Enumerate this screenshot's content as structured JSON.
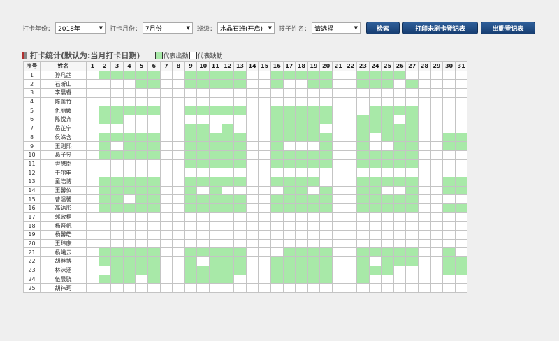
{
  "filters": {
    "year_label": "打卡年份：",
    "year_value": "2018年",
    "month_label": "打卡月份：",
    "month_value": "7月份",
    "class_label": "班级：",
    "class_value": "水晶石班(开启)",
    "child_label": "孩子姓名：",
    "child_value": "请选择"
  },
  "buttons": {
    "search": "检索",
    "print_unswiped": "打印未刷卡登记表",
    "attendance_sheet": "出勤登记表"
  },
  "section": {
    "title": "打卡统计(默认为:当月打卡日期)",
    "legend_present": "代表出勤",
    "legend_absent": "代表缺勤"
  },
  "colors": {
    "present": "#a8e9a8",
    "absent": "#ffffff",
    "accent": "#1f4f8a",
    "marker_red": "#b03030",
    "marker_gray": "#888888"
  },
  "table": {
    "col_index": "序号",
    "col_name": "姓名",
    "days": [
      "1",
      "2",
      "3",
      "4",
      "5",
      "6",
      "7",
      "8",
      "9",
      "10",
      "11",
      "12",
      "13",
      "14",
      "15",
      "16",
      "17",
      "18",
      "19",
      "20",
      "21",
      "22",
      "23",
      "24",
      "25",
      "26",
      "27",
      "28",
      "29",
      "30",
      "31"
    ],
    "rows": [
      {
        "no": "1",
        "name": "孙凡茜",
        "present": [
          2,
          3,
          4,
          5,
          6,
          9,
          10,
          11,
          12,
          13,
          16,
          17,
          18,
          19,
          20,
          23,
          24,
          25,
          26
        ]
      },
      {
        "no": "2",
        "name": "石昕山",
        "present": [
          5,
          6,
          9,
          10,
          11,
          12,
          13,
          16,
          19,
          20,
          23,
          24,
          25,
          27
        ]
      },
      {
        "no": "3",
        "name": "李晨睿",
        "present": []
      },
      {
        "no": "4",
        "name": "陈蕾竹",
        "present": []
      },
      {
        "no": "5",
        "name": "仇丽媛",
        "present": [
          2,
          3,
          4,
          5,
          6,
          9,
          10,
          11,
          12,
          13,
          16,
          17,
          18,
          19,
          20,
          24,
          25,
          26,
          27
        ]
      },
      {
        "no": "6",
        "name": "陈悦齐",
        "present": [
          2,
          3,
          16,
          17,
          18,
          19,
          20,
          23,
          24,
          25,
          27
        ]
      },
      {
        "no": "7",
        "name": "岳芷宁",
        "present": [
          9,
          10,
          12,
          16,
          17,
          18,
          19,
          23,
          24,
          25,
          26,
          27
        ]
      },
      {
        "no": "8",
        "name": "侯姝含",
        "present": [
          2,
          3,
          4,
          5,
          6,
          9,
          10,
          11,
          12,
          13,
          16,
          17,
          18,
          19,
          20,
          23,
          25,
          26,
          27,
          30,
          31
        ]
      },
      {
        "no": "9",
        "name": "王则熙",
        "present": [
          2,
          4,
          5,
          6,
          9,
          10,
          11,
          12,
          13,
          16,
          20,
          23,
          26,
          27,
          30,
          31
        ]
      },
      {
        "no": "10",
        "name": "葛子昱",
        "present": [
          2,
          3,
          4,
          5,
          6,
          9,
          10,
          11,
          12,
          13,
          16,
          17,
          18,
          19,
          20,
          23,
          24,
          25,
          26,
          27
        ]
      },
      {
        "no": "11",
        "name": "尹懋臣",
        "present": [
          9,
          10,
          11,
          12,
          13,
          16,
          17,
          18,
          19,
          20,
          23,
          24,
          25,
          26,
          27
        ]
      },
      {
        "no": "12",
        "name": "于尔申",
        "present": []
      },
      {
        "no": "13",
        "name": "童浩博",
        "present": [
          2,
          3,
          4,
          5,
          6,
          9,
          10,
          11,
          12,
          13,
          16,
          17,
          18,
          19,
          23,
          24,
          25,
          26,
          27,
          30,
          31
        ]
      },
      {
        "no": "14",
        "name": "王馨仪",
        "present": [
          2,
          3,
          4,
          5,
          6,
          9,
          11,
          17,
          18,
          20,
          23,
          24,
          27,
          30,
          31
        ]
      },
      {
        "no": "15",
        "name": "曹温馨",
        "present": [
          2,
          3,
          5,
          6,
          9,
          10,
          11,
          12,
          13,
          16,
          17,
          18,
          19,
          20,
          23,
          24,
          25,
          26,
          27
        ]
      },
      {
        "no": "16",
        "name": "高语彤",
        "present": [
          2,
          3,
          4,
          5,
          6,
          9,
          10,
          11,
          12,
          13,
          16,
          17,
          18,
          19,
          20,
          23,
          24,
          25,
          26,
          27,
          30,
          31
        ]
      },
      {
        "no": "17",
        "name": "郭政桐",
        "present": []
      },
      {
        "no": "18",
        "name": "杨晋帆",
        "present": []
      },
      {
        "no": "19",
        "name": "杨馨皓",
        "present": []
      },
      {
        "no": "20",
        "name": "王玮康",
        "present": []
      },
      {
        "no": "21",
        "name": "杨曦云",
        "present": [
          2,
          3,
          4,
          5,
          6,
          9,
          10,
          11,
          12,
          13,
          17,
          18,
          19,
          20,
          23,
          24,
          25,
          26,
          27,
          30
        ]
      },
      {
        "no": "22",
        "name": "胡尊博",
        "present": [
          2,
          3,
          4,
          5,
          6,
          9,
          11,
          12,
          13,
          16,
          17,
          18,
          19,
          20,
          23,
          25,
          26,
          27,
          30,
          31
        ]
      },
      {
        "no": "23",
        "name": "林沫涵",
        "present": [
          3,
          4,
          5,
          6,
          9,
          10,
          11,
          12,
          13,
          16,
          17,
          18,
          19,
          20,
          23,
          24,
          25,
          30,
          31
        ]
      },
      {
        "no": "24",
        "name": "伍晨骁",
        "present": [
          2,
          3,
          4,
          6,
          9,
          10,
          11,
          12,
          16,
          17,
          18,
          19,
          20,
          23
        ]
      },
      {
        "no": "25",
        "name": "胡祎珂",
        "present": []
      }
    ]
  }
}
